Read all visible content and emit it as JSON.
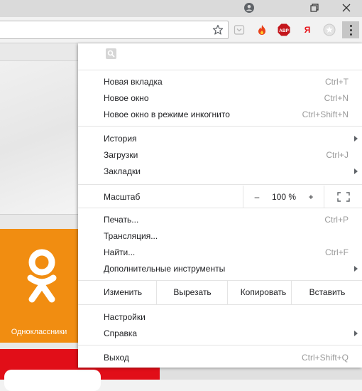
{
  "window": {
    "colors": {
      "titlebar": "#dadada",
      "toolbar": "#f2f2f2",
      "menu_bg": "#ffffff",
      "shortcut_text": "#9a9a9a"
    },
    "icons": [
      "account-icon",
      "restore-icon",
      "close-icon"
    ]
  },
  "toolbar": {
    "icons": [
      "star-icon",
      "pocket-icon",
      "fire-icon",
      "adblock-icon",
      "yandex-icon",
      "extension-icon",
      "more-vert-icon"
    ],
    "adblock_text": "ABP",
    "yandex_text": "Я"
  },
  "page": {
    "ok_label": "Одноклассники",
    "colors": {
      "ok_orange": "#f18d11",
      "red": "#e10e18"
    }
  },
  "menu": {
    "search_icon": "search-icon",
    "new_tab": {
      "label": "Новая вкладка",
      "shortcut": "Ctrl+T"
    },
    "new_window": {
      "label": "Новое окно",
      "shortcut": "Ctrl+N"
    },
    "incognito": {
      "label": "Новое окно в режиме инкогнито",
      "shortcut": "Ctrl+Shift+N"
    },
    "history": {
      "label": "История"
    },
    "downloads": {
      "label": "Загрузки",
      "shortcut": "Ctrl+J"
    },
    "bookmarks": {
      "label": "Закладки"
    },
    "zoom": {
      "label": "Масштаб",
      "minus": "–",
      "value": "100 %",
      "plus": "+"
    },
    "print": {
      "label": "Печать...",
      "shortcut": "Ctrl+P"
    },
    "cast": {
      "label": "Трансляция..."
    },
    "find": {
      "label": "Найти...",
      "shortcut": "Ctrl+F"
    },
    "more_tools": {
      "label": "Дополнительные инструменты"
    },
    "edit": {
      "label": "Изменить",
      "cut": "Вырезать",
      "copy": "Копировать",
      "paste": "Вставить"
    },
    "settings": {
      "label": "Настройки"
    },
    "help": {
      "label": "Справка"
    },
    "exit": {
      "label": "Выход",
      "shortcut": "Ctrl+Shift+Q"
    }
  }
}
